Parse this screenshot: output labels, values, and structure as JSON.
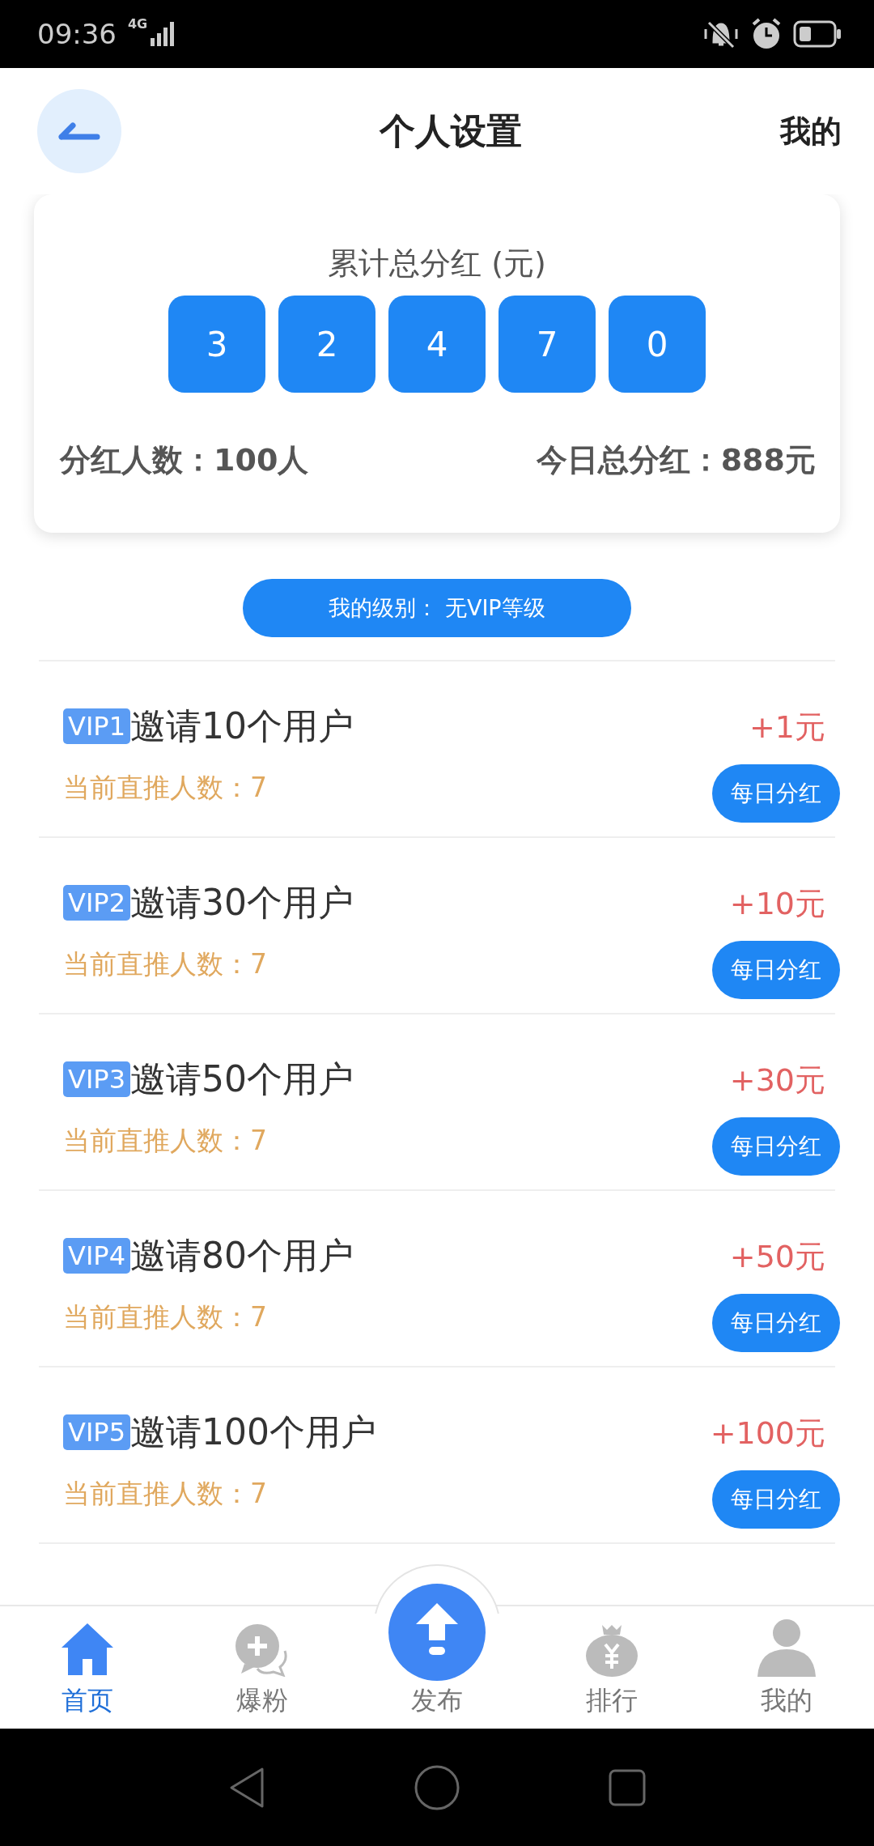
{
  "status_bar": {
    "time": "09:36",
    "network": "4G"
  },
  "header": {
    "title": "个人设置",
    "right_link": "我的"
  },
  "summary": {
    "label": "累计总分红 (元)",
    "digits": [
      "3",
      "2",
      "4",
      "7",
      "0"
    ],
    "members": "分红人数：100人",
    "today": "今日总分红：888元"
  },
  "level_button": "我的级别： 无VIP等级",
  "levels": [
    {
      "badge": "VIP1",
      "title": "邀请10个用户",
      "progress": "当前直推人数：7",
      "reward": "+1元",
      "button": "每日分红"
    },
    {
      "badge": "VIP2",
      "title": "邀请30个用户",
      "progress": "当前直推人数：7",
      "reward": "+10元",
      "button": "每日分红"
    },
    {
      "badge": "VIP3",
      "title": "邀请50个用户",
      "progress": "当前直推人数：7",
      "reward": "+30元",
      "button": "每日分红"
    },
    {
      "badge": "VIP4",
      "title": "邀请80个用户",
      "progress": "当前直推人数：7",
      "reward": "+50元",
      "button": "每日分红"
    },
    {
      "badge": "VIP5",
      "title": "邀请100个用户",
      "progress": "当前直推人数：7",
      "reward": "+100元",
      "button": "每日分红"
    }
  ],
  "tabs": [
    {
      "label": "首页",
      "selected": true,
      "kind": "home"
    },
    {
      "label": "爆粉",
      "selected": false,
      "kind": "chat"
    },
    {
      "label": "发布",
      "selected": false,
      "kind": "publish"
    },
    {
      "label": "排行",
      "selected": false,
      "kind": "money"
    },
    {
      "label": "我的",
      "selected": false,
      "kind": "user"
    }
  ]
}
